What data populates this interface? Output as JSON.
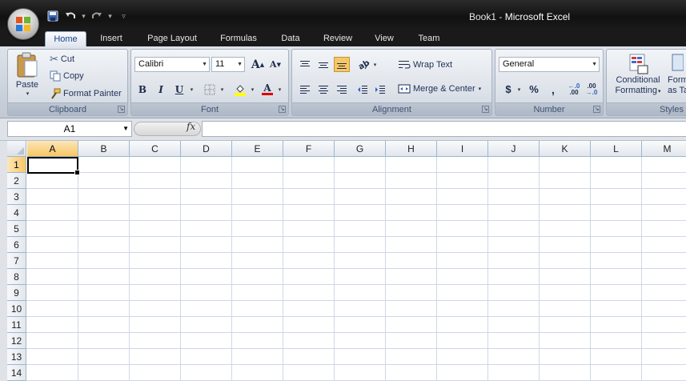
{
  "window": {
    "doc_name": "Book1",
    "separator": " - ",
    "app_name": "Microsoft Excel"
  },
  "qat": {
    "save_icon": "save-icon",
    "undo_icon": "undo-icon",
    "redo_icon": "redo-icon",
    "customize_icon": "customize-qat-icon"
  },
  "tabs": [
    "Home",
    "Insert",
    "Page Layout",
    "Formulas",
    "Data",
    "Review",
    "View",
    "Team"
  ],
  "clipboard": {
    "label": "Clipboard",
    "paste": "Paste",
    "cut": "Cut",
    "copy": "Copy",
    "format_painter": "Format Painter"
  },
  "font": {
    "label": "Font",
    "family": "Calibri",
    "size": "11",
    "bold": "B",
    "italic": "I",
    "underline": "U",
    "grow": "A",
    "shrink": "A",
    "color_letter": "A"
  },
  "alignment": {
    "label": "Alignment",
    "wrap_text": "Wrap Text",
    "merge_center": "Merge & Center"
  },
  "number": {
    "label": "Number",
    "format": "General",
    "currency": "$",
    "percent": "%",
    "comma": ",",
    "inc_decimal": ".00",
    "dec_decimal": ".00"
  },
  "styles": {
    "conditional_line1": "Conditional",
    "conditional_line2": "Formatting",
    "format_table_line1": "Format",
    "format_table_line2": "as Table",
    "label": "Styles"
  },
  "formula_bar": {
    "name_box": "A1",
    "fx": "fx",
    "value": ""
  },
  "sheet": {
    "columns": [
      "A",
      "B",
      "C",
      "D",
      "E",
      "F",
      "G",
      "H",
      "I",
      "J",
      "K",
      "L",
      "M"
    ],
    "rows": [
      "1",
      "2",
      "3",
      "4",
      "5",
      "6",
      "7",
      "8",
      "9",
      "10",
      "11",
      "12",
      "13",
      "14"
    ],
    "selected_cell": "A1"
  },
  "colors": {
    "accent_selected_header": "#f8c765",
    "titlebar": "#111111",
    "ribbon": "#dde2e9"
  }
}
